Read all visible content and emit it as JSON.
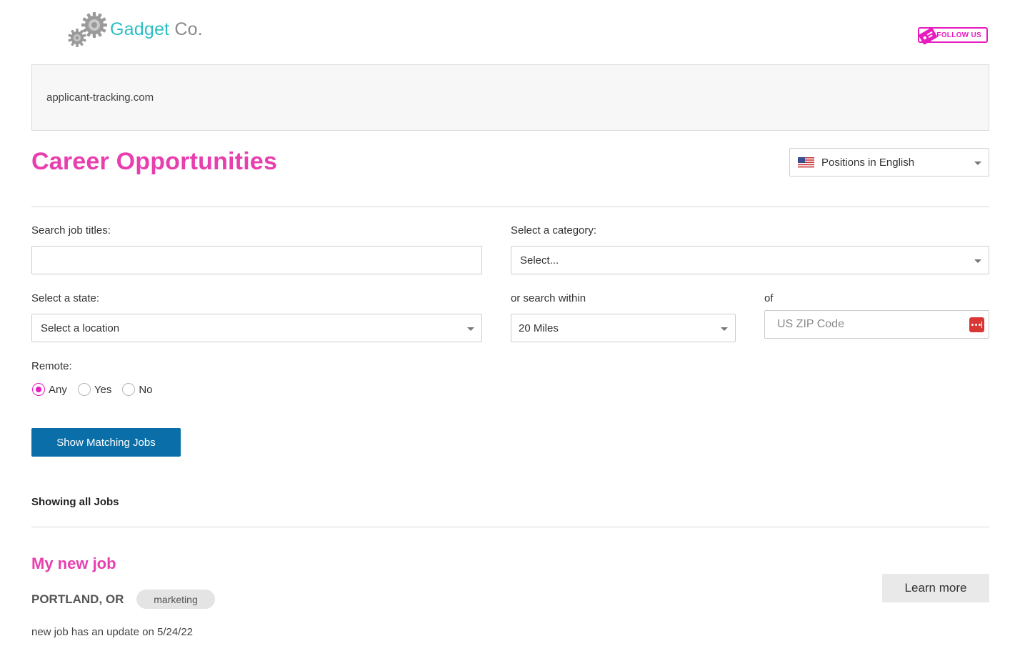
{
  "header": {
    "logo_text_primary": "Gadget",
    "logo_text_secondary": "Co.",
    "follow_label": "FOLLOW US"
  },
  "banner": {
    "text": "applicant-tracking.com"
  },
  "page": {
    "title": "Career Opportunities",
    "language_select": "Positions in English"
  },
  "form": {
    "job_title_label": "Search job titles:",
    "job_title_value": "",
    "category_label": "Select a category:",
    "category_value": "Select...",
    "state_label": "Select a state:",
    "state_value": "Select a location",
    "radius_label": "or search within",
    "radius_value": "20 Miles",
    "zip_label": "of",
    "zip_placeholder": "US ZIP Code",
    "remote_label": "Remote:",
    "remote_options": [
      {
        "label": "Any",
        "selected": true
      },
      {
        "label": "Yes",
        "selected": false
      },
      {
        "label": "No",
        "selected": false
      }
    ],
    "submit_label": "Show Matching Jobs"
  },
  "results": {
    "summary": "Showing all Jobs",
    "jobs": [
      {
        "title": "My new job",
        "location": "PORTLAND, OR",
        "category": "marketing",
        "update": "new job has an update on 5/24/22",
        "action_label": "Learn more"
      }
    ]
  },
  "colors": {
    "accent_pink": "#e83fae",
    "primary_button": "#0a6fa8",
    "logo_teal": "#2bbfc4"
  }
}
